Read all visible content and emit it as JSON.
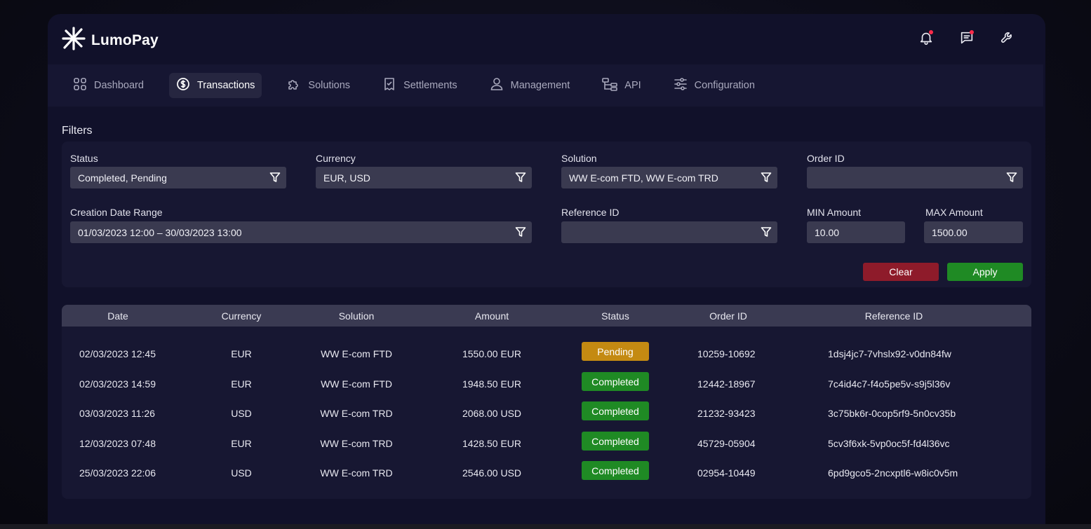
{
  "brand": {
    "name": "LumoPay",
    "accent": "#ffffff"
  },
  "header": {
    "icons": [
      "bell-icon",
      "message-icon",
      "wrench-icon"
    ],
    "notification_color": "#ff2b4a"
  },
  "nav": {
    "items": [
      {
        "label": "Dashboard",
        "icon": "grid-icon",
        "active": false
      },
      {
        "label": "Transactions",
        "icon": "dollar-circle-icon",
        "active": true
      },
      {
        "label": "Solutions",
        "icon": "puzzle-icon",
        "active": false
      },
      {
        "label": "Settlements",
        "icon": "receipt-check-icon",
        "active": false
      },
      {
        "label": "Management",
        "icon": "user-icon",
        "active": false
      },
      {
        "label": "API",
        "icon": "hierarchy-icon",
        "active": false
      },
      {
        "label": "Configuration",
        "icon": "sliders-icon",
        "active": false
      }
    ]
  },
  "filters": {
    "title": "Filters",
    "status": {
      "label": "Status",
      "value": "Completed, Pending"
    },
    "currency": {
      "label": "Currency",
      "value": "EUR, USD"
    },
    "solution": {
      "label": "Solution",
      "value": "WW E-com FTD, WW E-com TRD"
    },
    "order_id": {
      "label": "Order ID",
      "value": ""
    },
    "date_range": {
      "label": "Creation Date Range",
      "value": "01/03/2023 12:00 – 30/03/2023 13:00"
    },
    "reference_id": {
      "label": "Reference ID",
      "value": ""
    },
    "min_amount": {
      "label": "MIN Amount",
      "value": "10.00"
    },
    "max_amount": {
      "label": "MAX Amount",
      "value": "1500.00"
    },
    "clear_label": "Clear",
    "apply_label": "Apply"
  },
  "table": {
    "headers": [
      "Date",
      "Currency",
      "Solution",
      "Amount",
      "Status",
      "Order ID",
      "Reference ID"
    ],
    "rows": [
      {
        "date": "02/03/2023 12:45",
        "currency": "EUR",
        "solution": "WW E-com FTD",
        "amount": "1550.00 EUR",
        "status": "Pending",
        "order_id": "10259-10692",
        "reference_id": "1dsj4jc7-7vhslx92-v0dn84fw"
      },
      {
        "date": "02/03/2023 14:59",
        "currency": "EUR",
        "solution": "WW E-com FTD",
        "amount": "1948.50 EUR",
        "status": "Completed",
        "order_id": "12442-18967",
        "reference_id": "7c4id4c7-f4o5pe5v-s9j5l36v"
      },
      {
        "date": "03/03/2023 11:26",
        "currency": "USD",
        "solution": "WW E-com TRD",
        "amount": "2068.00 USD",
        "status": "Completed",
        "order_id": "21232-93423",
        "reference_id": "3c75bk6r-0cop5rf9-5n0cv35b"
      },
      {
        "date": "12/03/2023 07:48",
        "currency": "EUR",
        "solution": "WW E-com TRD",
        "amount": "1428.50 EUR",
        "status": "Completed",
        "order_id": "45729-05904",
        "reference_id": "5cv3f6xk-5vp0oc5f-fd4l36vc"
      },
      {
        "date": "25/03/2023 22:06",
        "currency": "USD",
        "solution": "WW E-com TRD",
        "amount": "2546.00 USD",
        "status": "Completed",
        "order_id": "02954-10449",
        "reference_id": "6pd9gco5-2ncxptl6-w8ic0v5m"
      }
    ]
  },
  "status_colors": {
    "Pending": "#c48a12",
    "Completed": "#1f8a24"
  }
}
